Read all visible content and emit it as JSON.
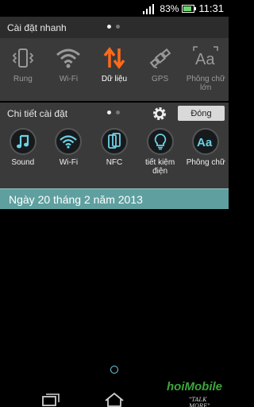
{
  "status_bar": {
    "battery_percent_label": "83%",
    "battery_level": 0.83,
    "time": "11:31"
  },
  "quick_settings": {
    "title": "Cài đặt nhanh",
    "tiles": [
      {
        "label": "Rung",
        "icon": "vibrate-icon",
        "active": false
      },
      {
        "label": "Wi-Fi",
        "icon": "wifi-icon",
        "active": false
      },
      {
        "label": "Dữ liệu",
        "icon": "mobile-data-icon",
        "active": true
      },
      {
        "label": "GPS",
        "icon": "gps-satellite-icon",
        "active": false
      },
      {
        "label": "Phông chữ lớn",
        "icon": "large-font-icon",
        "active": false
      }
    ]
  },
  "settings_detail": {
    "title": "Chi tiết cài đặt",
    "close_label": "Đóng",
    "tiles": [
      {
        "label": "Sound",
        "icon": "music-note-icon"
      },
      {
        "label": "Wi-Fi",
        "icon": "wifi-icon"
      },
      {
        "label": "NFC",
        "icon": "nfc-phone-icon"
      },
      {
        "label": "tiết kiệm điện",
        "icon": "power-saving-bulb-icon"
      },
      {
        "label": "Phông chữ",
        "icon": "font-icon"
      }
    ]
  },
  "date_bar": {
    "text": "Ngày 20 tháng 2 năm 2013"
  },
  "watermark": {
    "logo": "hoiMobile",
    "tagline": "\"TALK MORE\""
  },
  "colors": {
    "accent_active": "#ff6a1a",
    "date_bar": "#5f9f9f",
    "panel_bg": "#3a3a3a",
    "header_bg": "#2c2c2c"
  }
}
